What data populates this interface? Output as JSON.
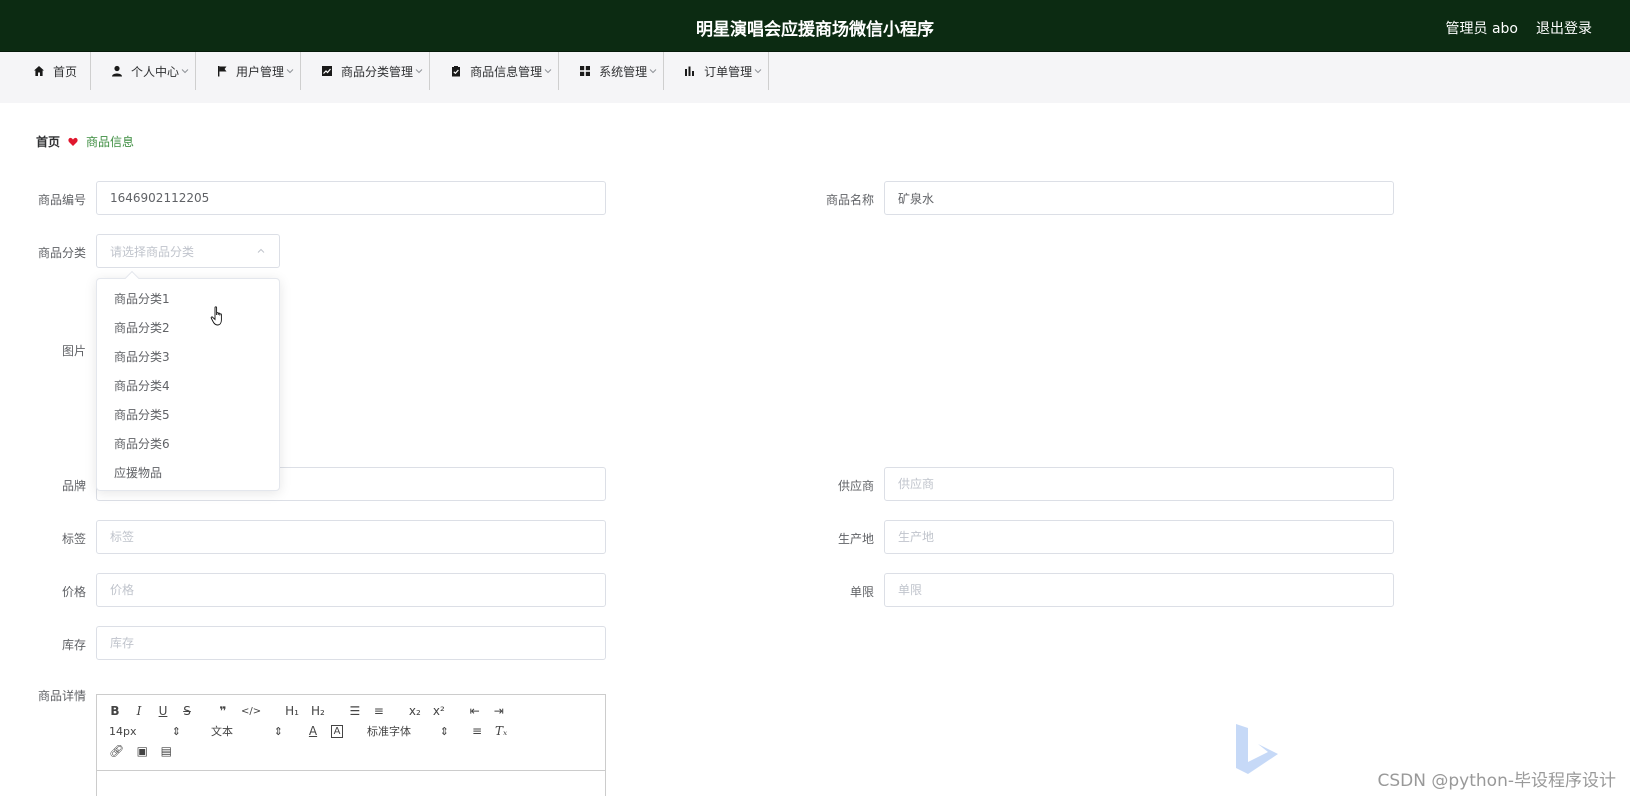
{
  "header": {
    "title": "明星演唱会应援商场微信小程序",
    "admin": "管理员 abo",
    "logout": "退出登录"
  },
  "nav": {
    "items": [
      {
        "label": "首页",
        "icon": "home-icon",
        "dropdown": false
      },
      {
        "label": "个人中心",
        "icon": "user-icon",
        "dropdown": true
      },
      {
        "label": "用户管理",
        "icon": "flag-icon",
        "dropdown": true
      },
      {
        "label": "商品分类管理",
        "icon": "chart-icon",
        "dropdown": true
      },
      {
        "label": "商品信息管理",
        "icon": "clipboard-icon",
        "dropdown": true
      },
      {
        "label": "系统管理",
        "icon": "grid-icon",
        "dropdown": true
      },
      {
        "label": "订单管理",
        "icon": "bar-chart-icon",
        "dropdown": true
      }
    ]
  },
  "breadcrumb": {
    "home": "首页",
    "current": "商品信息"
  },
  "form": {
    "product_code": {
      "label": "商品编号",
      "value": "1646902112205"
    },
    "product_name": {
      "label": "商品名称",
      "value": "矿泉水"
    },
    "category": {
      "label": "商品分类",
      "placeholder": "请选择商品分类"
    },
    "image": {
      "label": "图片"
    },
    "brand": {
      "label": "品牌",
      "placeholder": ""
    },
    "supplier": {
      "label": "供应商",
      "placeholder": "供应商"
    },
    "tag": {
      "label": "标签",
      "placeholder": "标签"
    },
    "origin": {
      "label": "生产地",
      "placeholder": "生产地"
    },
    "price": {
      "label": "价格",
      "placeholder": "价格"
    },
    "limit": {
      "label": "单限",
      "placeholder": "单限"
    },
    "stock": {
      "label": "库存",
      "placeholder": "库存"
    },
    "detail": {
      "label": "商品详情"
    }
  },
  "category_options": [
    "商品分类1",
    "商品分类2",
    "商品分类3",
    "商品分类4",
    "商品分类5",
    "商品分类6",
    "应援物品"
  ],
  "editor": {
    "font_size": "14px",
    "text_type": "文本",
    "font_family": "标准字体"
  },
  "watermark": {
    "text": "CSDN @python-毕设程序设计"
  },
  "colors": {
    "header_bg": "#0c2b12",
    "nav_bg": "#f5f5f7",
    "breadcrumb_active": "#3e8e41",
    "heart": "#e0172e"
  }
}
